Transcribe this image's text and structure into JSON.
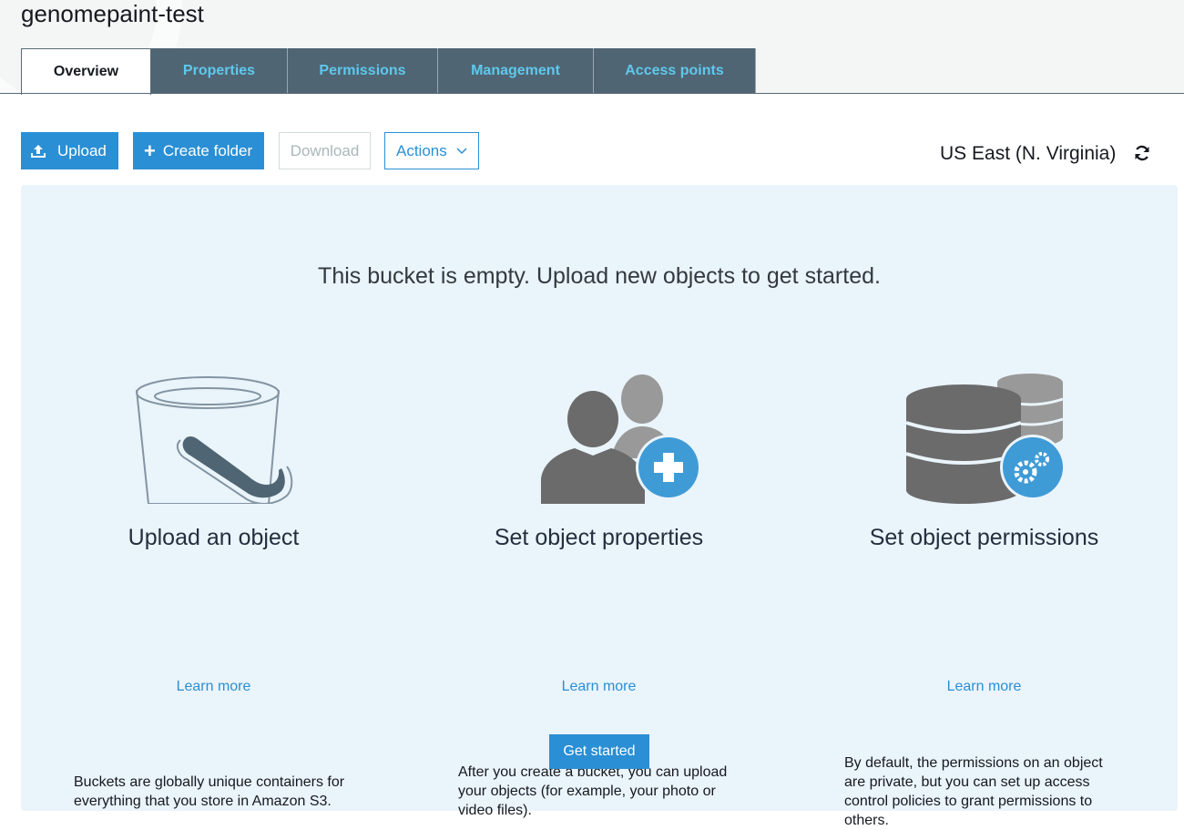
{
  "bucket": {
    "name": "genomepaint-test"
  },
  "tabs": [
    {
      "label": "Overview",
      "active": true
    },
    {
      "label": "Properties",
      "active": false
    },
    {
      "label": "Permissions",
      "active": false
    },
    {
      "label": "Management",
      "active": false
    },
    {
      "label": "Access points",
      "active": false
    }
  ],
  "toolbar": {
    "upload_label": "Upload",
    "create_folder_label": "Create folder",
    "download_label": "Download",
    "actions_label": "Actions",
    "region": "US East (N. Virginia)"
  },
  "empty_state": {
    "message": "This bucket is empty. Upload new objects to get started.",
    "columns": [
      {
        "icon": "bucket-icon",
        "title": "Upload an object",
        "description": "Buckets are globally unique containers for everything that you store in Amazon S3.",
        "link": "Learn more"
      },
      {
        "icon": "users-add-icon",
        "title": "Set object properties",
        "description": "After you create a bucket, you can upload your objects (for example, your photo or video files).",
        "link": "Learn more"
      },
      {
        "icon": "database-gear-icon",
        "title": "Set object permissions",
        "description": "By default, the permissions on an object are private, but you can set up access control policies to grant permissions to others.",
        "link": "Learn more"
      }
    ],
    "cta_label": "Get started"
  },
  "colors": {
    "accent": "#2a8fd4",
    "tab_bg": "#4f6573",
    "tab_text": "#5fc8ec",
    "panel_bg": "#eaf4fb",
    "icon_gray": "#6b6b6b"
  }
}
